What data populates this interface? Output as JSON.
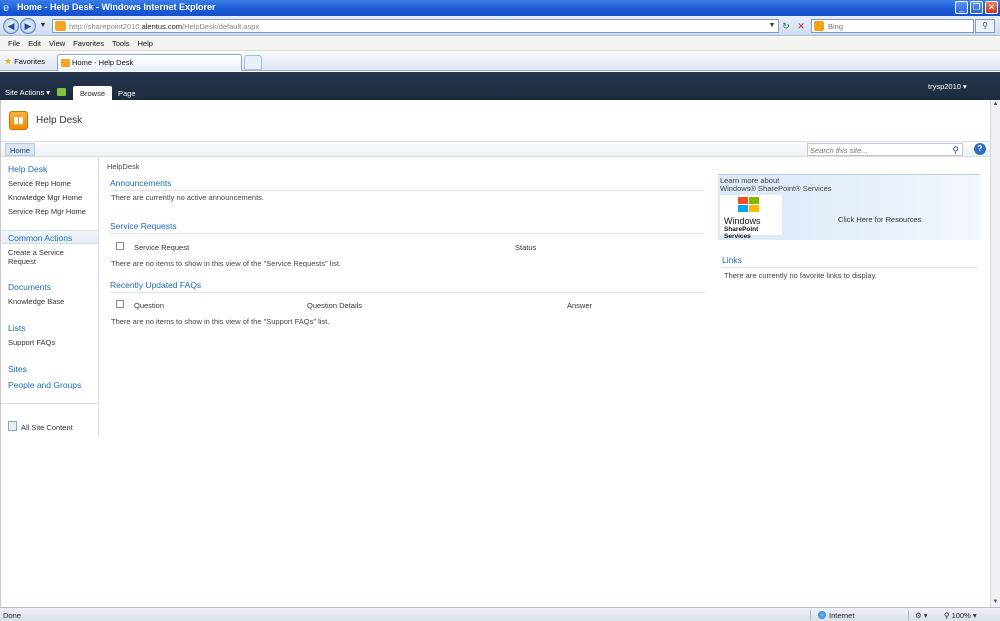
{
  "browser": {
    "window_title": "Home - Help Desk - Windows Internet Explorer",
    "url_prefix": "http://sharepoint2010.",
    "url_domain": "alentus.com",
    "url_path": "/HelpDesk/default.aspx",
    "search_placeholder": "Bing",
    "menu": [
      "File",
      "Edit",
      "View",
      "Favorites",
      "Tools",
      "Help"
    ],
    "favorites_label": "Favorites",
    "tab_title": "Home - Help Desk",
    "status_text": "Done",
    "zone": "Internet",
    "zoom": "100%"
  },
  "ribbon": {
    "site_actions": "Site Actions",
    "tabs": [
      "Browse",
      "Page"
    ],
    "user": "trysp2010"
  },
  "site": {
    "title": "Help Desk",
    "topnav_home": "Home",
    "search_placeholder": "Search this site...",
    "breadcrumb": "HelpDesk"
  },
  "leftnav": {
    "helpdesk_header": "Help Desk",
    "helpdesk_items": [
      "Service Rep Home",
      "Knowledge Mgr Home",
      "Service Rep Mgr Home"
    ],
    "common_actions_header": "Common Actions",
    "create_service_request_line1": "Create a Service",
    "create_service_request_line2": "Request",
    "documents_header": "Documents",
    "documents_items": [
      "Knowledge Base"
    ],
    "lists_header": "Lists",
    "lists_items": [
      "Support FAQs"
    ],
    "sites_header": "Sites",
    "people_header": "People and Groups",
    "all_site_content": "All Site Content"
  },
  "main": {
    "announcements_title": "Announcements",
    "announcements_empty": "There are currently no active announcements.",
    "service_requests_title": "Service Requests",
    "service_requests_columns": [
      "Service Request",
      "Status"
    ],
    "service_requests_empty": "There are no items to show in this view of the \"Service Requests\" list.",
    "faqs_title": "Recently Updated FAQs",
    "faqs_columns": [
      "Question",
      "Question Details",
      "Answer"
    ],
    "faqs_empty": "There are no items to show in this view of the \"Support FAQs\" list."
  },
  "right": {
    "promo_line1": "Learn more about",
    "promo_line2": "Windows® SharePoint® Services",
    "promo_logo_windows": "Windows",
    "promo_logo_sub": "SharePoint Services",
    "promo_link": "Click Here for Resources",
    "links_title": "Links",
    "links_empty": "There are currently no favorite links to display."
  }
}
